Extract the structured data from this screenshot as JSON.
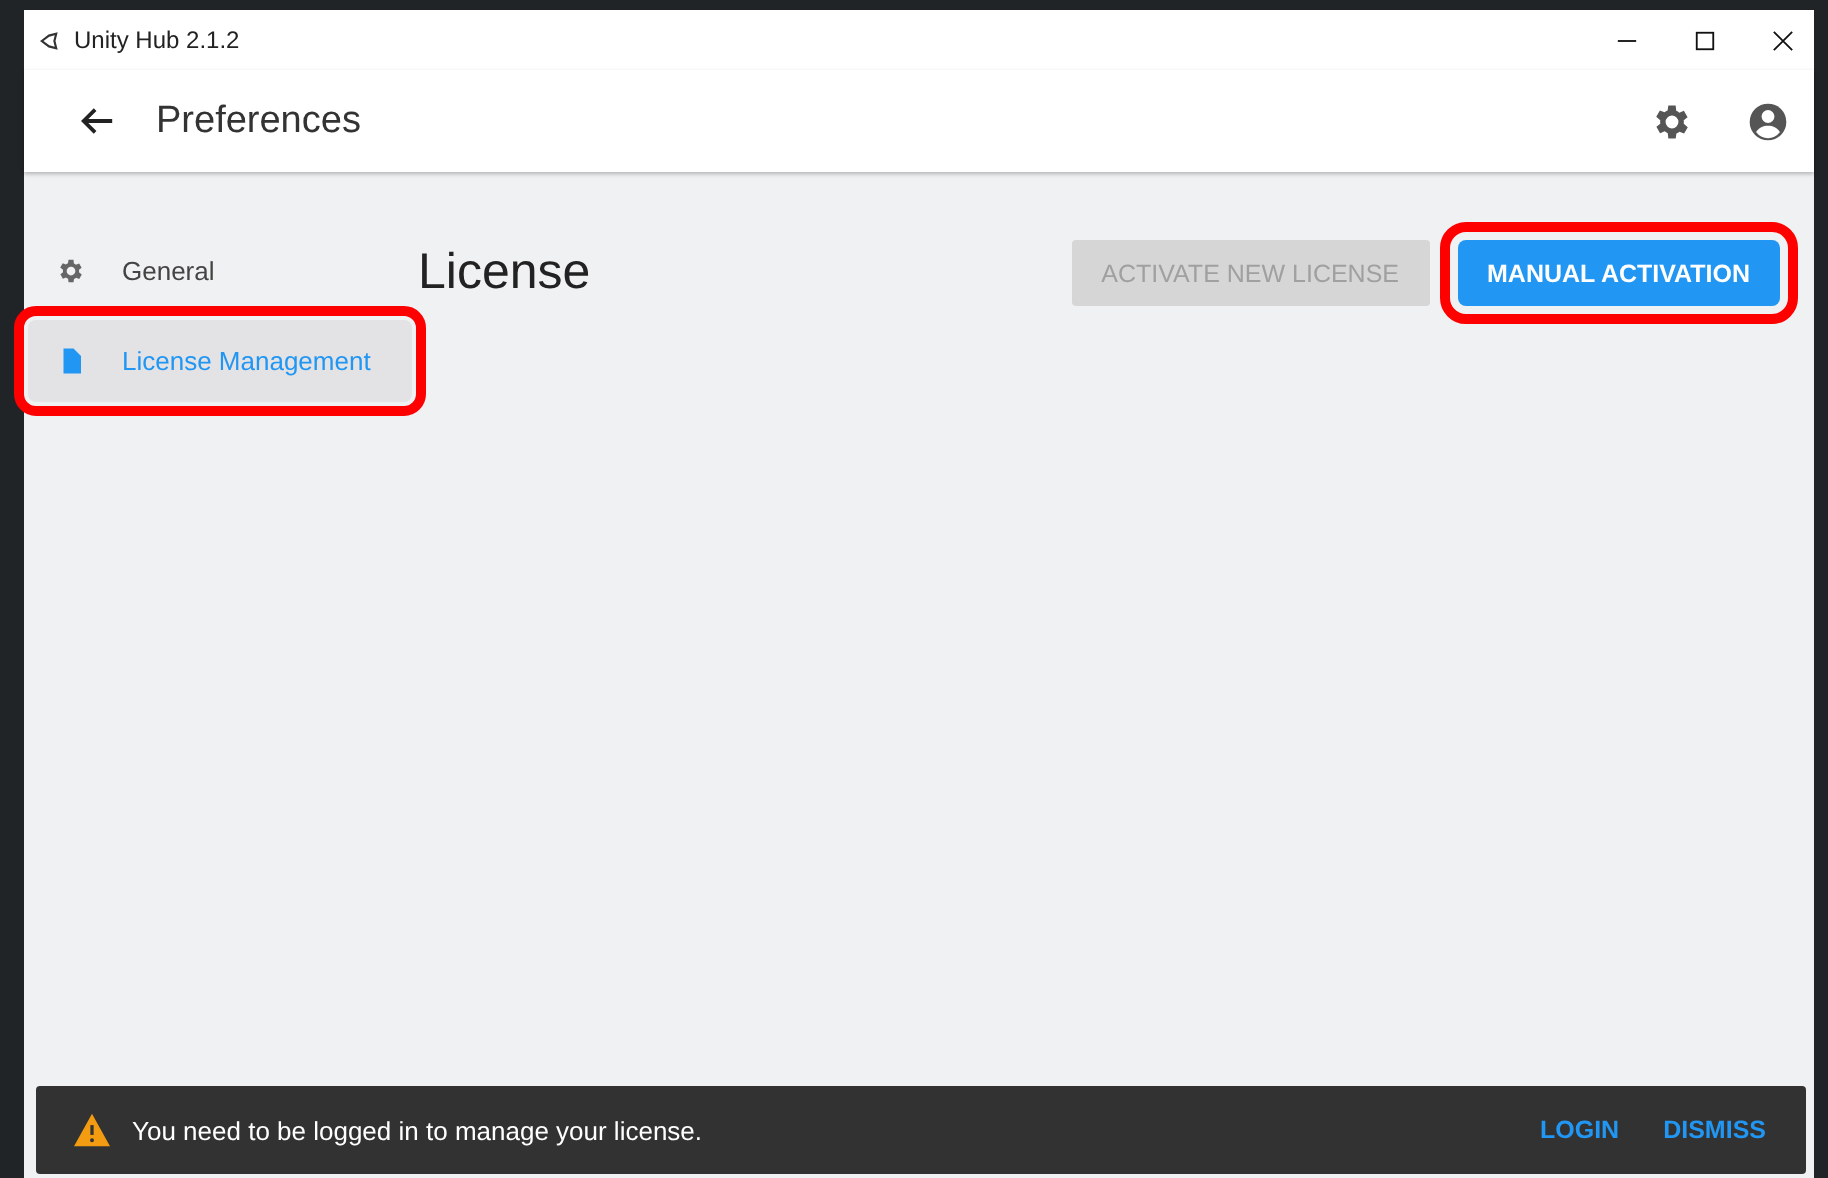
{
  "window": {
    "title": "Unity Hub 2.1.2"
  },
  "header": {
    "title": "Preferences"
  },
  "sidebar": {
    "items": [
      {
        "label": "General",
        "kind": "general",
        "selected": false,
        "highlighted": false
      },
      {
        "label": "License Management",
        "kind": "license",
        "selected": true,
        "highlighted": true
      }
    ]
  },
  "content": {
    "title": "License",
    "buttons": [
      {
        "label": "ACTIVATE NEW LICENSE",
        "disabled": true,
        "highlighted": false
      },
      {
        "label": "MANUAL ACTIVATION",
        "disabled": false,
        "highlighted": true
      }
    ]
  },
  "snackbar": {
    "message": "You need to be logged in to manage your license.",
    "actions": [
      "LOGIN",
      "DISMISS"
    ]
  }
}
